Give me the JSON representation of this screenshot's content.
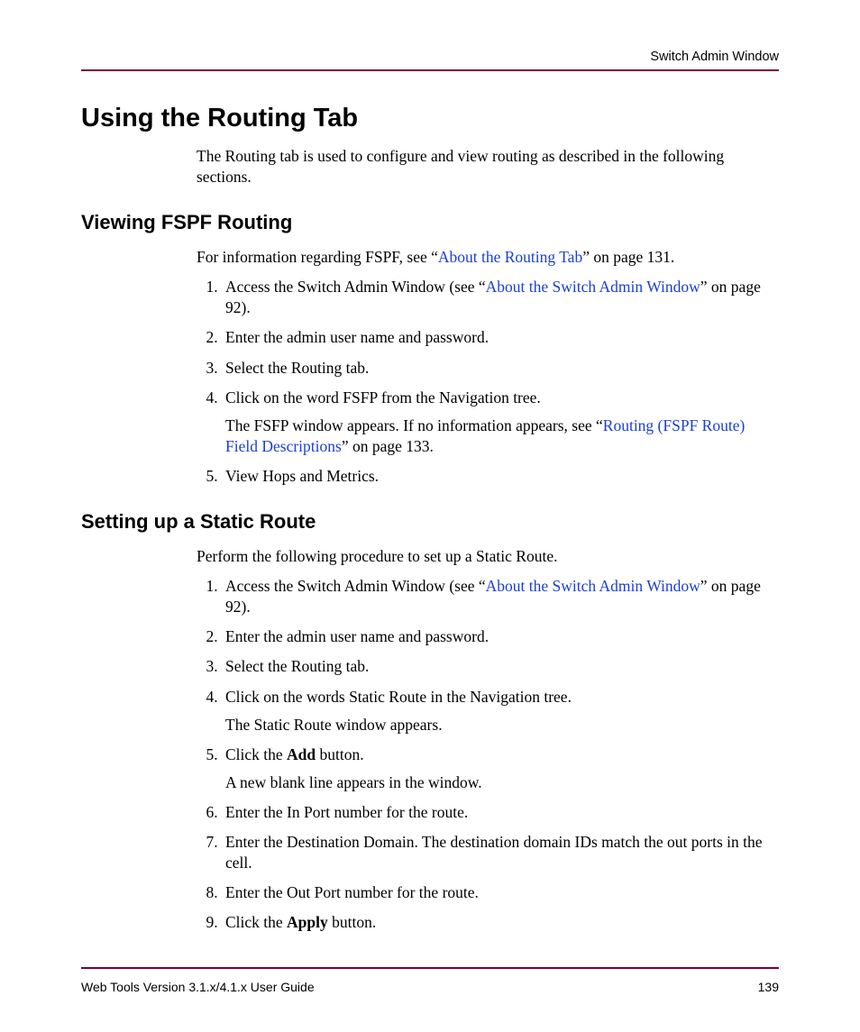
{
  "header": {
    "running_head": "Switch Admin Window"
  },
  "h1": "Using the Routing Tab",
  "intro": "The Routing tab is used to configure and view routing as described in the following sections.",
  "section1": {
    "heading": "Viewing FSPF Routing",
    "lead_pre": "For information regarding FSPF, see “",
    "lead_link": "About the Routing Tab",
    "lead_post": "” on page 131.",
    "steps": {
      "s1_pre": "Access the Switch Admin Window (see “",
      "s1_link": "About the Switch Admin Window",
      "s1_post": "” on page 92).",
      "s2": "Enter the admin user name and password.",
      "s3": "Select the Routing tab.",
      "s4": "Click on the word FSFP from the Navigation tree.",
      "s4b_pre": "The FSFP window appears. If no information appears, see “",
      "s4b_link": "Routing (FSPF Route) Field Descriptions",
      "s4b_post": "” on page 133.",
      "s5": "View Hops and Metrics."
    }
  },
  "section2": {
    "heading": "Setting up a Static Route",
    "lead": "Perform the following procedure to set up a Static Route.",
    "steps": {
      "s1_pre": "Access the Switch Admin Window (see “",
      "s1_link": "About the Switch Admin Window",
      "s1_post": "” on page 92).",
      "s2": "Enter the admin user name and password.",
      "s3": "Select the Routing tab.",
      "s4": "Click on the words Static Route in the Navigation tree.",
      "s4b": "The Static Route window appears.",
      "s5_pre": "Click the ",
      "s5_bold": "Add",
      "s5_post": " button.",
      "s5b": "A new blank line appears in the window.",
      "s6": "Enter the In Port number for the route.",
      "s7": "Enter the Destination Domain. The destination domain IDs match the out ports in the cell.",
      "s8": "Enter the Out Port number for the route.",
      "s9_pre": "Click the ",
      "s9_bold": "Apply",
      "s9_post": " button."
    }
  },
  "footer": {
    "title": "Web Tools Version 3.1.x/4.1.x User Guide",
    "page": "139"
  }
}
